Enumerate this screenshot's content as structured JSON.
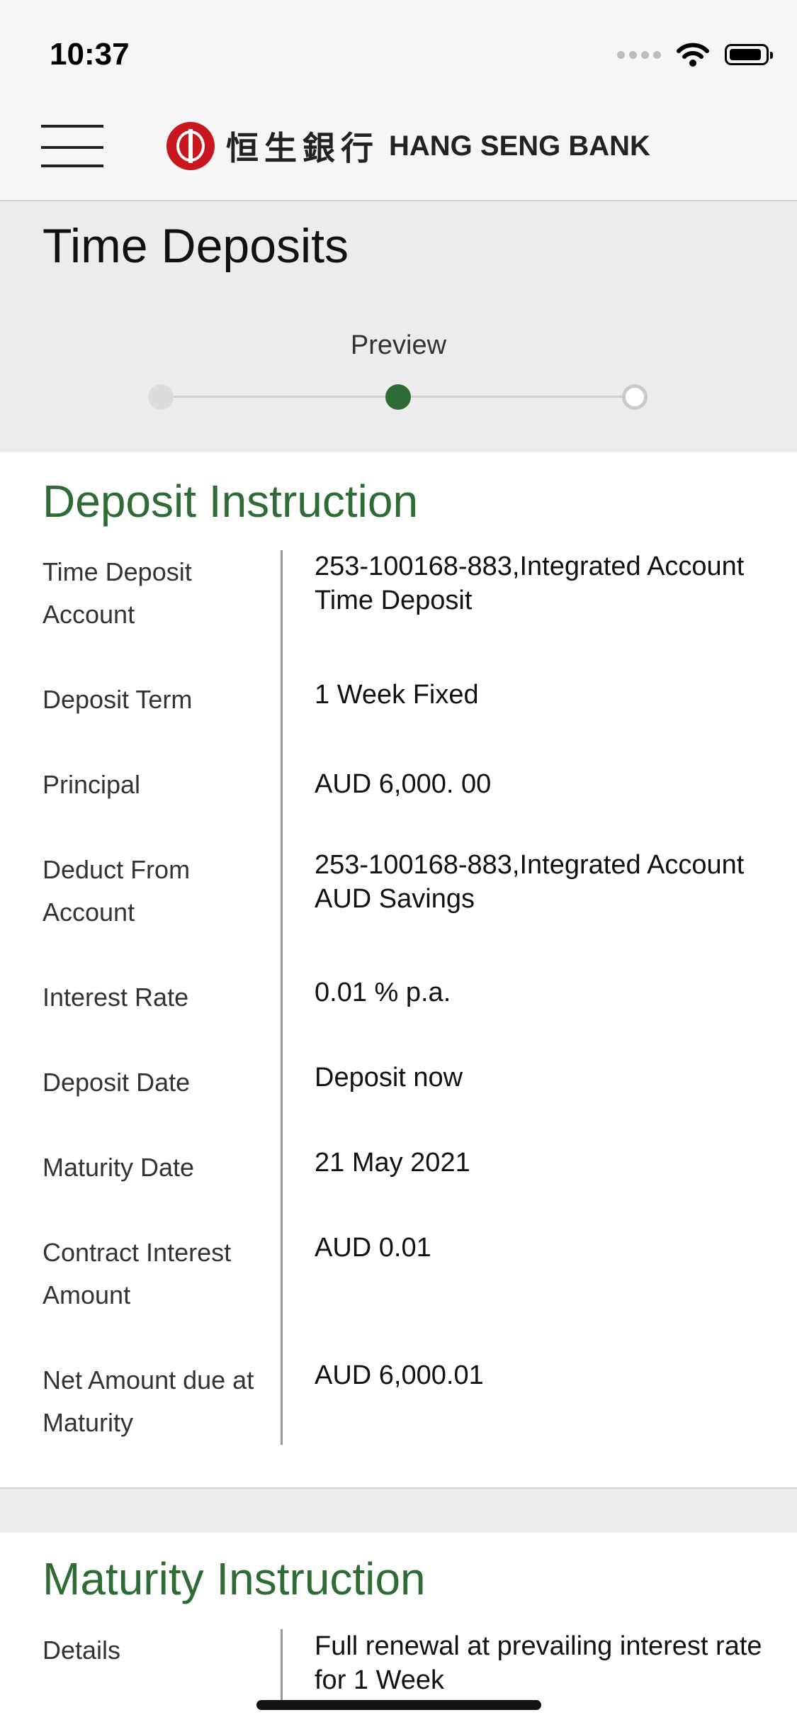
{
  "status_bar": {
    "time": "10:37",
    "icons": [
      "cellular-icon",
      "wifi-icon",
      "battery-icon"
    ]
  },
  "header": {
    "logo_chinese": "恒生銀行",
    "logo_english": "HANG SENG BANK",
    "menu_icon": "hamburger-icon"
  },
  "page": {
    "title": "Time Deposits",
    "step_label": "Preview",
    "current_step": 2,
    "total_steps": 3
  },
  "deposit_instruction": {
    "title": "Deposit Instruction",
    "rows": [
      {
        "label": "Time Deposit Account",
        "value": "253-100168-883,Integrated Account Time Deposit"
      },
      {
        "label": "Deposit Term",
        "value": "1 Week Fixed"
      },
      {
        "label": "Principal",
        "value": "AUD 6,000. 00"
      },
      {
        "label": "Deduct From Account",
        "value": "253-100168-883,Integrated Account AUD Savings"
      },
      {
        "label": "Interest Rate",
        "value": "0.01 % p.a."
      },
      {
        "label": "Deposit Date",
        "value": "Deposit now"
      },
      {
        "label": "Maturity Date",
        "value": "21 May 2021"
      },
      {
        "label": "Contract Interest Amount",
        "value": "AUD 0.01"
      },
      {
        "label": "Net Amount due at Maturity",
        "value": "AUD 6,000.01"
      }
    ]
  },
  "maturity_instruction": {
    "title": "Maturity Instruction",
    "rows": [
      {
        "label": "Details",
        "value": "Full renewal at prevailing interest rate for 1 Week"
      }
    ]
  },
  "colors": {
    "accent_green": "#2e6b35",
    "brand_red": "#c8171e",
    "band_gray": "#ececec"
  }
}
